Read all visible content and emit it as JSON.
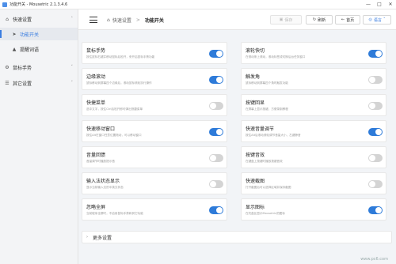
{
  "window": {
    "title": "功能开关 - Mousetric 2.1.3.4.6",
    "controls": [
      "—",
      "□",
      "✕"
    ]
  },
  "sidebar": {
    "items": [
      {
        "label": "快速设置",
        "icon": "home-icon",
        "glyph": "⌂",
        "caret": "˄",
        "active": false
      },
      {
        "label": "功能开关",
        "icon": "send-icon",
        "glyph": "➤",
        "caret": "",
        "active": true
      },
      {
        "label": "提醒词语",
        "icon": "warning-icon",
        "glyph": "▲",
        "caret": "",
        "active": false
      },
      {
        "label": "鼠标手势",
        "icon": "gear-icon",
        "glyph": "⚙",
        "caret": "˅",
        "active": false
      },
      {
        "label": "其它设置",
        "icon": "sliders-icon",
        "glyph": "☰",
        "caret": "˅",
        "active": false
      }
    ]
  },
  "toolbar": {
    "breadcrumb_home": "⌂",
    "breadcrumb_parent": "快速设置",
    "breadcrumb_separator": ">",
    "breadcrumb_current": "功能开关",
    "btn_save": "保存",
    "btn_refresh": "刷新",
    "btn_home": "首页",
    "btn_language": "语言"
  },
  "toggles": [
    {
      "title": "鼠标手势",
      "desc": "按住鼠标右键并移动鼠标后松开，来开启鼠标手势功能",
      "on": true
    },
    {
      "title": "滚轮快切",
      "desc": "在滚动条上滚动，滚动标签或切换后台任务窗口",
      "on": true
    },
    {
      "title": "边缘滚动",
      "desc": "鼠标移动到屏幕四个边缘后，滚动鼠标滚轮执行操作",
      "on": true
    },
    {
      "title": "触发角",
      "desc": "鼠标移动到屏幕四个角时触发功能",
      "on": false
    },
    {
      "title": "快捷菜单",
      "desc": "选中文字，按住Ctrl后松开即可弹出快捷菜单",
      "on": false
    },
    {
      "title": "按键回显",
      "desc": "在屏幕上显示按键，方便录制教程",
      "on": false
    },
    {
      "title": "快速移动窗口",
      "desc": "按住Alt在窗口任意位置拖动，可以移动窗口",
      "on": true
    },
    {
      "title": "快速音量调节",
      "desc": "按住Alt后滚动滚轮调节音量大小，左键静音",
      "on": true
    },
    {
      "title": "音量回馈",
      "desc": "音量调节时播放提示音",
      "on": false
    },
    {
      "title": "按键音效",
      "desc": "在键盘上按键时播放按键音效",
      "on": false
    },
    {
      "title": "输入法状态显示",
      "desc": "显示当前输入法的中英文状态",
      "on": false
    },
    {
      "title": "快速截图",
      "desc": "打开截图后可以选择区域并保存截图",
      "on": false
    },
    {
      "title": "忽略全屏",
      "desc": "当前程序全屏时，不启用鼠标手势和其它功能",
      "on": true
    },
    {
      "title": "显示图标",
      "desc": "在托盘区显示Mousetric的图标",
      "on": true
    }
  ],
  "more_settings": {
    "icon": "chevron-right-icon",
    "glyph": "›",
    "label": "更多设置"
  },
  "watermark": "www.pc6.com"
}
